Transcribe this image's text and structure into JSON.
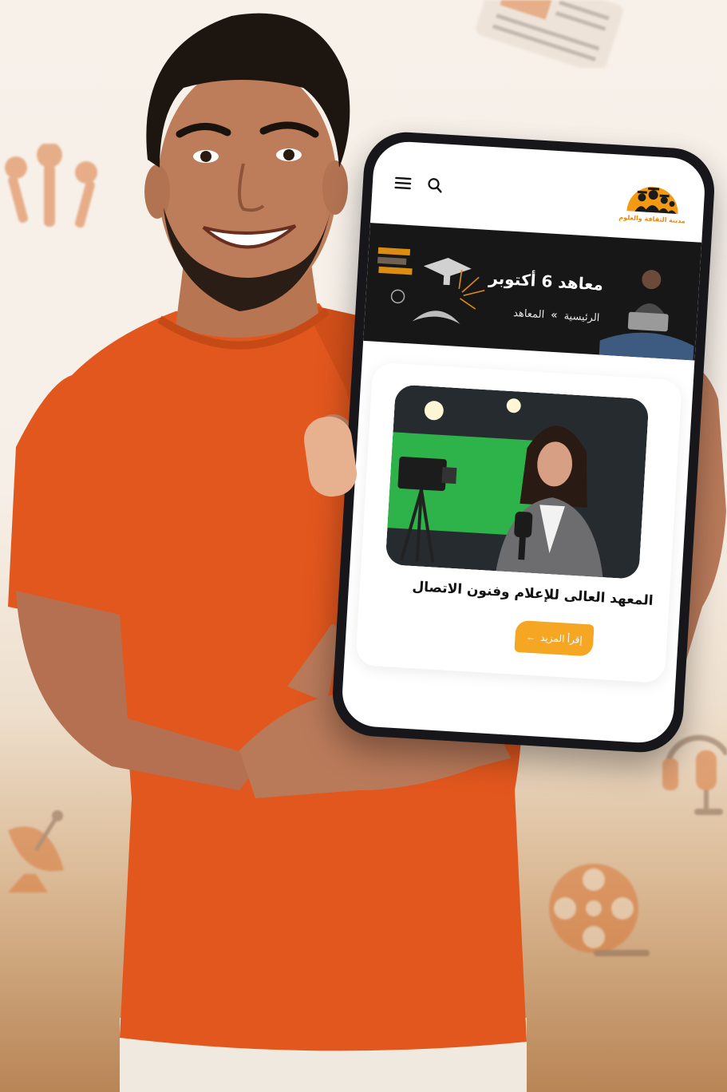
{
  "app": {
    "logo_caption": "مدينة الثقافة والعلوم",
    "logo_colors": {
      "brand": "#f39a12"
    }
  },
  "header": {
    "menu_icon": "hamburger-icon",
    "search_icon": "search-icon"
  },
  "banner": {
    "title": "معاهد 6 أكتوبر",
    "breadcrumb": [
      "الرئيسية",
      "المعاهد"
    ],
    "separator": "»"
  },
  "card": {
    "title": "المعهد العالى للإعلام وفنون الاتصال",
    "button_label": "إقرأ المزيد",
    "button_icon": "arrow-left-icon"
  },
  "colors": {
    "accent": "#f5a623",
    "shirt": "#e2571e",
    "banner_bg": "#171717"
  }
}
